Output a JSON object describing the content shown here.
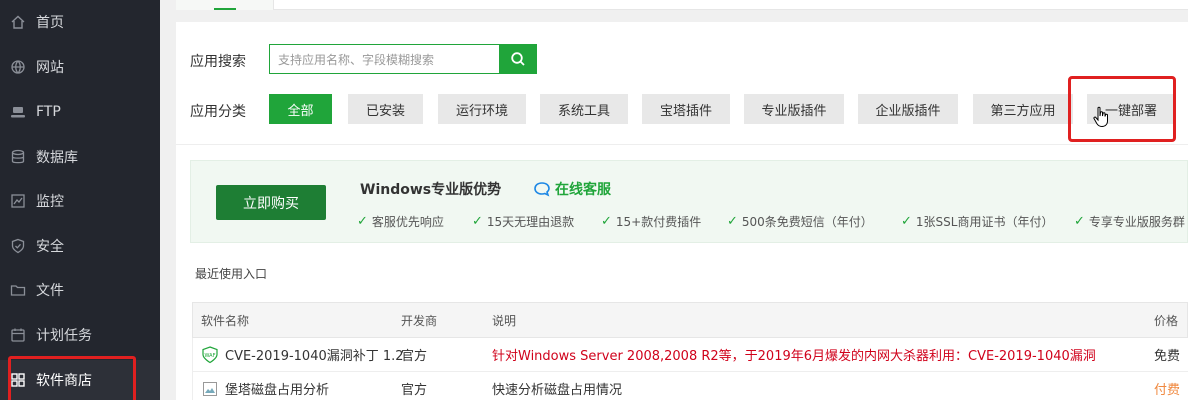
{
  "sidebar": {
    "items": [
      {
        "label": "首页",
        "icon": "home-icon"
      },
      {
        "label": "网站",
        "icon": "globe-icon"
      },
      {
        "label": "FTP",
        "icon": "ftp-icon"
      },
      {
        "label": "数据库",
        "icon": "database-icon"
      },
      {
        "label": "监控",
        "icon": "monitor-icon"
      },
      {
        "label": "安全",
        "icon": "shield-icon"
      },
      {
        "label": "文件",
        "icon": "folder-icon"
      },
      {
        "label": "计划任务",
        "icon": "calendar-icon"
      },
      {
        "label": "软件商店",
        "icon": "grid-icon",
        "active": true
      }
    ]
  },
  "search": {
    "label": "应用搜索",
    "placeholder": "支持应用名称、字段模糊搜索"
  },
  "categories": {
    "label": "应用分类",
    "items": [
      "全部",
      "已安装",
      "运行环境",
      "系统工具",
      "宝塔插件",
      "专业版插件",
      "企业版插件",
      "第三方应用",
      "一键部署"
    ],
    "active_index": 0
  },
  "promo": {
    "buy_label": "立即购买",
    "title": "Windows专业版优势",
    "service_label": "在线客服",
    "perks": [
      "客服优先响应",
      "15天无理由退款",
      "15+款付费插件",
      "500条免费短信（年付）",
      "1张SSL商用证书（年付）",
      "专享专业版服务群"
    ]
  },
  "recent": {
    "label": "最近使用入口"
  },
  "table": {
    "headers": {
      "name": "软件名称",
      "developer": "开发商",
      "description": "说明",
      "price": "价格"
    },
    "rows": [
      {
        "name": "CVE-2019-1040漏洞补丁 1.2",
        "developer": "官方",
        "description": "针对Windows Server 2008,2008 R2等，于2019年6月爆发的内网大杀器利用：CVE-2019-1040漏洞",
        "price": "免费",
        "icon": "waf-icon"
      },
      {
        "name": "堡塔磁盘占用分析",
        "developer": "官方",
        "description": "快速分析磁盘占用情况",
        "price": "付费",
        "icon": "broken-image-icon"
      }
    ]
  },
  "colors": {
    "accent": "#20a53a",
    "sidebar_bg": "#23262e",
    "highlight_red": "#e02020"
  }
}
